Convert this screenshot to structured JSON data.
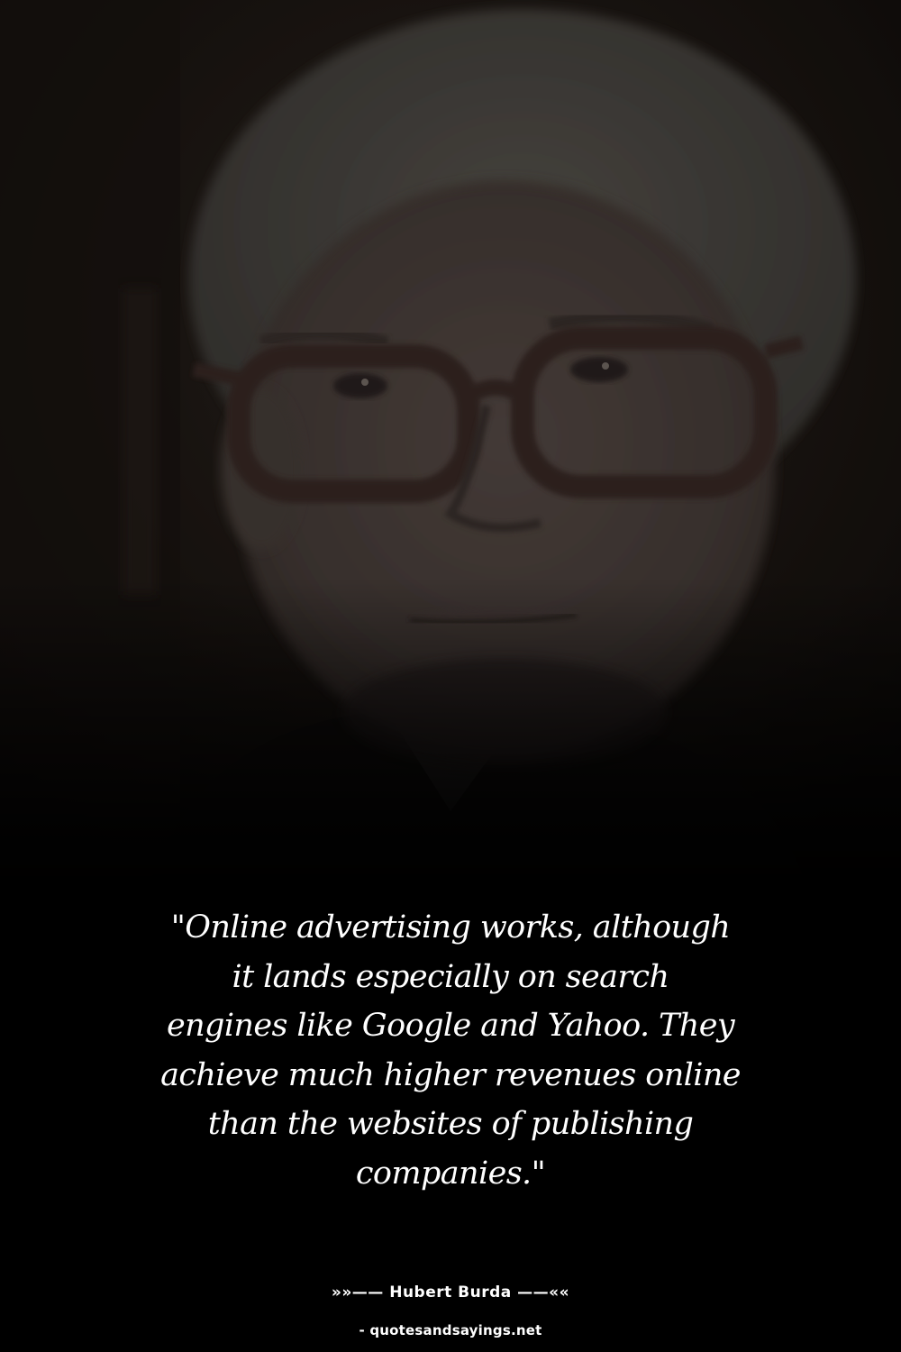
{
  "quote": {
    "lines": [
      "\"Online advertising works, although",
      "it lands especially on search",
      "engines like Google and Yahoo. They",
      "achieve much higher revenues online",
      "than the websites of publishing",
      "companies.\""
    ]
  },
  "author": {
    "label": "»»—— Hubert Burda ——««"
  },
  "source": {
    "label": "- quotesandsayings.net"
  },
  "colors": {
    "background": "#000000",
    "text": "#ffffff"
  }
}
